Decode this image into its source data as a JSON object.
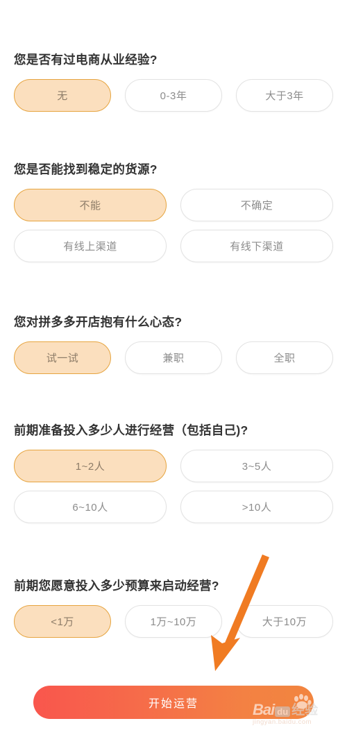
{
  "survey": {
    "questions": [
      {
        "id": "ecommerce-experience",
        "title": "您是否有过电商从业经验?",
        "columns": 3,
        "rows": [
          [
            {
              "label": "无",
              "selected": true
            },
            {
              "label": "0-3年",
              "selected": false
            },
            {
              "label": "大于3年",
              "selected": false
            }
          ]
        ]
      },
      {
        "id": "stable-supply",
        "title": "您是否能找到稳定的货源?",
        "columns": 2,
        "rows": [
          [
            {
              "label": "不能",
              "selected": true
            },
            {
              "label": "不确定",
              "selected": false
            }
          ],
          [
            {
              "label": "有线上渠道",
              "selected": false
            },
            {
              "label": "有线下渠道",
              "selected": false
            }
          ]
        ]
      },
      {
        "id": "attitude",
        "title": "您对拼多多开店抱有什么心态?",
        "columns": 3,
        "rows": [
          [
            {
              "label": "试一试",
              "selected": true
            },
            {
              "label": "兼职",
              "selected": false
            },
            {
              "label": "全职",
              "selected": false
            }
          ]
        ]
      },
      {
        "id": "team-size",
        "title": "前期准备投入多少人进行经营（包括自己)?",
        "columns": 2,
        "rows": [
          [
            {
              "label": "1~2人",
              "selected": true
            },
            {
              "label": "3~5人",
              "selected": false
            }
          ],
          [
            {
              "label": "6~10人",
              "selected": false
            },
            {
              "label": ">10人",
              "selected": false
            }
          ]
        ]
      },
      {
        "id": "budget",
        "title": "前期您愿意投入多少预算来启动经营?",
        "columns": 3,
        "rows": [
          [
            {
              "label": "<1万",
              "selected": true
            },
            {
              "label": "1万~10万",
              "selected": false
            },
            {
              "label": "大于10万",
              "selected": false
            }
          ]
        ]
      }
    ]
  },
  "start_button": {
    "label": "开始运营"
  },
  "annotation": {
    "arrow_icon": "arrow-down-left-icon",
    "color": "#F07B22"
  },
  "watermark": {
    "bai": "Bai",
    "du": "du",
    "chinese": "经验",
    "url": "jingyan.baidu.com"
  },
  "colors": {
    "selected_fill": "#FBDFBE",
    "selected_border": "#E6A43F",
    "selected_text": "#8D7C68",
    "unselected_border": "#E2E2E2",
    "unselected_text": "#8C8C8C",
    "question_text": "#333333",
    "button_gradient_start": "#F9564D",
    "button_gradient_end": "#F2853F",
    "arrow": "#F07B22"
  }
}
